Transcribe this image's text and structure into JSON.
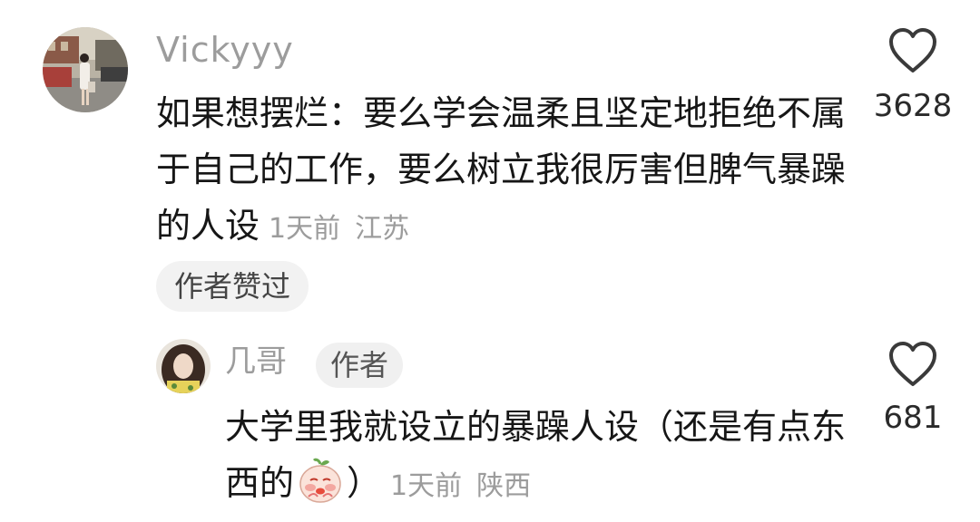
{
  "comments": [
    {
      "username": "Vickyyy",
      "text": "如果想摆烂：要么学会温柔且坚定地拒绝不属于自己的工作，要么树立我很厉害但脾气暴躁的人设",
      "time": "1天前",
      "location": "江苏",
      "badge": "作者赞过",
      "like_count": "3628",
      "like_icon": "heart-outline-icon",
      "replies": [
        {
          "username": "几哥",
          "tag": "作者",
          "text_before_emoji": "大学里我就设立的暴躁人设（还是有点东西的",
          "emoji": "pleading-face-emoji",
          "text_after_emoji": "）",
          "time": "1天前",
          "location": "陕西",
          "like_count": "681",
          "like_icon": "heart-outline-icon"
        }
      ]
    }
  ]
}
